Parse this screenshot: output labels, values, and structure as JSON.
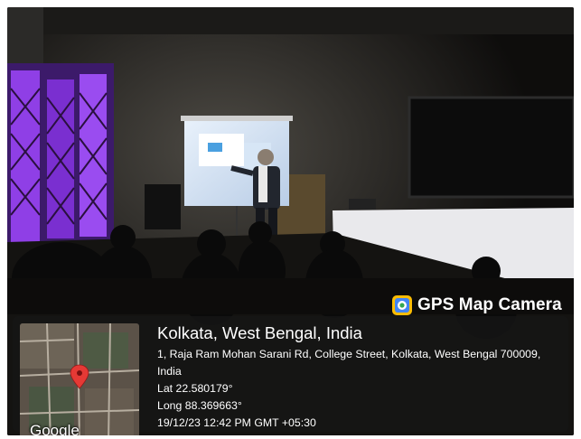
{
  "badge": {
    "app_name": "GPS Map Camera",
    "icon": "gps-map-camera-app-icon"
  },
  "map": {
    "provider_logo": "Google",
    "pin_color": "#e53935"
  },
  "location": {
    "title": "Kolkata, West Bengal, India",
    "address_line1": "1, Raja Ram Mohan Sarani Rd, College Street, Kolkata, West Bengal 700009,",
    "address_line2": "India",
    "latitude": "Lat 22.580179°",
    "longitude": "Long 88.369663°",
    "timestamp": "19/12/23 12:42 PM GMT +05:30"
  },
  "colors": {
    "overlay_bg": "#161616",
    "text": "#ffffff",
    "curtain": "#7a2fd0"
  }
}
